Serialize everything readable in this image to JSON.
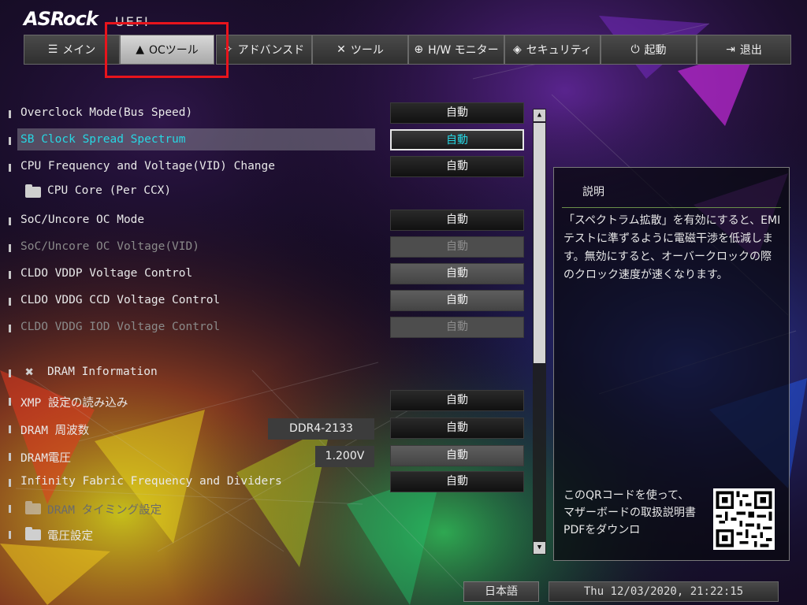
{
  "header": {
    "brand": "ASRock",
    "brand_suffix": "UEFI"
  },
  "tabs": [
    {
      "label": "メイン",
      "icon": "list-icon"
    },
    {
      "label": "OCツール",
      "icon": "rocket-icon",
      "active": true
    },
    {
      "label": "アドバンスド",
      "icon": "star-icon"
    },
    {
      "label": "ツール",
      "icon": "tools-icon"
    },
    {
      "label": "H/W モニター",
      "icon": "globe-icon"
    },
    {
      "label": "セキュリティ",
      "icon": "shield-icon"
    },
    {
      "label": "起動",
      "icon": "power-icon"
    },
    {
      "label": "退出",
      "icon": "exit-icon"
    }
  ],
  "settings": [
    {
      "label": "Overclock Mode(Bus Speed)",
      "value": "自動"
    },
    {
      "label": "SB Clock Spread Spectrum",
      "value": "自動",
      "selected": true
    },
    {
      "label": "CPU Frequency and Voltage(VID) Change",
      "value": "自動"
    },
    {
      "label": "CPU Core (Per CCX)",
      "type": "folder"
    },
    {
      "label": "SoC/Uncore OC Mode",
      "value": "自動"
    },
    {
      "label": "SoC/Uncore OC Voltage(VID)",
      "value": "自動",
      "disabled": true
    },
    {
      "label": "CLDO VDDP Voltage Control",
      "value": "自動"
    },
    {
      "label": "CLDO VDDG CCD Voltage Control",
      "value": "自動"
    },
    {
      "label": "CLDO VDDG IOD Voltage Control",
      "value": "自動",
      "disabled": true
    },
    {
      "label": "DRAM Information",
      "type": "tool"
    },
    {
      "label": "XMP 設定の読み込み",
      "value": "自動"
    },
    {
      "label": "DRAM 周波数",
      "value": "自動",
      "current": "DDR4-2133"
    },
    {
      "label": "DRAM電圧",
      "value": "自動",
      "current": "1.200V"
    },
    {
      "label": "Infinity Fabric Frequency and Dividers",
      "value": "自動"
    },
    {
      "label": "DRAM タイミング設定",
      "type": "folder",
      "disabled": true
    },
    {
      "label": "電圧設定",
      "type": "folder"
    }
  ],
  "description": {
    "title": "説明",
    "text": "「スペクトラム拡散」を有効にすると、EMI テストに準ずるように電磁干渉を低減します。無効にすると、オーバークロックの際のクロック速度が速くなります。",
    "qr_text": "このQRコードを使って、マザーボードの取扱説明書PDFをダウンロ"
  },
  "footer": {
    "language": "日本語",
    "datetime": "Thu 12/03/2020, 21:22:15"
  }
}
